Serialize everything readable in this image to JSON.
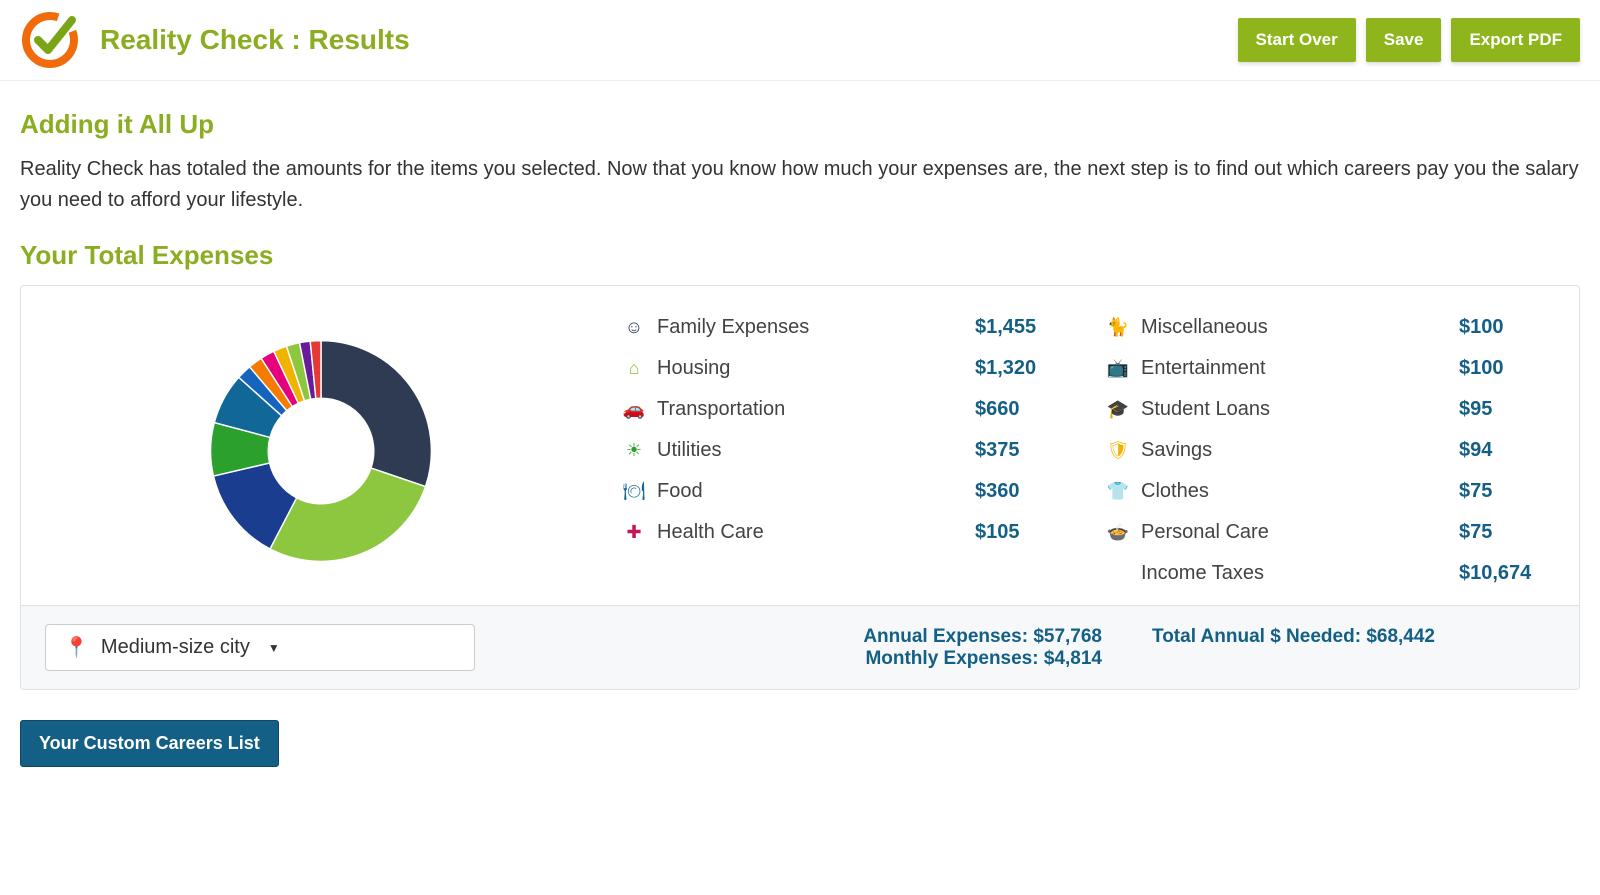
{
  "header": {
    "title": "Reality Check : Results",
    "buttons": {
      "start_over": "Start Over",
      "save": "Save",
      "export": "Export PDF"
    }
  },
  "section": {
    "adding_up_title": "Adding it All Up",
    "intro": "Reality Check has totaled the amounts for the items you selected. Now that you know how much your expenses are, the next step is to find out which careers pay you the salary you need to afford your lifestyle.",
    "total_title": "Your Total Expenses"
  },
  "chart_data": {
    "type": "pie",
    "title": "Your Total Expenses",
    "series": [
      {
        "name": "Family Expenses",
        "value": 1455,
        "color": "#2e3b52"
      },
      {
        "name": "Housing",
        "value": 1320,
        "color": "#8dc63f"
      },
      {
        "name": "Transportation",
        "value": 660,
        "color": "#1a3d8f"
      },
      {
        "name": "Utilities",
        "value": 375,
        "color": "#2ca02c"
      },
      {
        "name": "Food",
        "value": 360,
        "color": "#126799"
      },
      {
        "name": "Health Care",
        "value": 105,
        "color": "#1565c0"
      },
      {
        "name": "Miscellaneous",
        "value": 100,
        "color": "#f57c00"
      },
      {
        "name": "Entertainment",
        "value": 100,
        "color": "#e6007e"
      },
      {
        "name": "Student Loans",
        "value": 95,
        "color": "#f0b400"
      },
      {
        "name": "Savings",
        "value": 94,
        "color": "#8dc63f"
      },
      {
        "name": "Clothes",
        "value": 75,
        "color": "#6a1b9a"
      },
      {
        "name": "Personal Care",
        "value": 75,
        "color": "#e53935"
      }
    ]
  },
  "legend": {
    "left": [
      {
        "label": "Family Expenses",
        "value": "$1,455",
        "icon": "☺",
        "cls": "ic-navy"
      },
      {
        "label": "Housing",
        "value": "$1,320",
        "icon": "⌂",
        "cls": "ic-green"
      },
      {
        "label": "Transportation",
        "value": "$660",
        "icon": "🚗",
        "cls": "ic-dblue"
      },
      {
        "label": "Utilities",
        "value": "$375",
        "icon": "☀",
        "cls": "ic-teal"
      },
      {
        "label": "Food",
        "value": "$360",
        "icon": "🍽",
        "cls": "ic-blue2"
      },
      {
        "label": "Health Care",
        "value": "$105",
        "icon": "✚",
        "cls": "ic-mag"
      }
    ],
    "right": [
      {
        "label": "Miscellaneous",
        "value": "$100",
        "icon": "🐈",
        "cls": "ic-orange"
      },
      {
        "label": "Entertainment",
        "value": "$100",
        "icon": "📺",
        "cls": "ic-pink"
      },
      {
        "label": "Student Loans",
        "value": "$95",
        "icon": "🎓",
        "cls": "ic-sky"
      },
      {
        "label": "Savings",
        "value": "$94",
        "icon": "🛡",
        "cls": "ic-gold"
      },
      {
        "label": "Clothes",
        "value": "$75",
        "icon": "👕",
        "cls": "ic-purple"
      },
      {
        "label": "Personal Care",
        "value": "$75",
        "icon": "🍲",
        "cls": "ic-red"
      },
      {
        "label": "Income Taxes",
        "value": "$10,674",
        "icon": "",
        "cls": ""
      }
    ]
  },
  "footer": {
    "city_selected": "Medium-size city",
    "annual_label": "Annual Expenses:",
    "annual_value": "$57,768",
    "monthly_label": "Monthly Expenses:",
    "monthly_value": "$4,814",
    "total_needed_label": "Total Annual $ Needed:",
    "total_needed_value": "$68,442"
  },
  "careers_btn": "Your Custom Careers List"
}
